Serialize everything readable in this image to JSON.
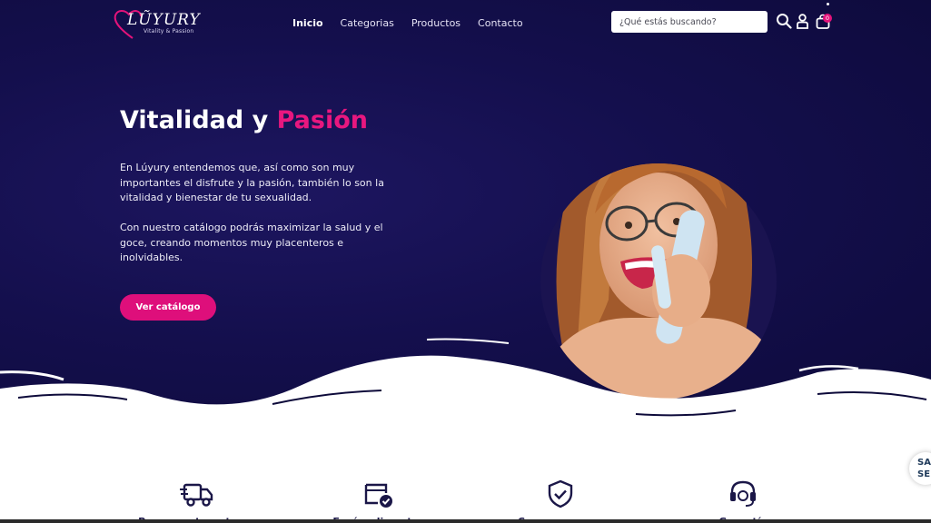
{
  "nav": {
    "brand": "LŨYURY",
    "tagline": "Vitality & Passion",
    "links": [
      "Inicio",
      "Categorias",
      "Productos",
      "Contacto"
    ],
    "active_index": 0,
    "search_placeholder": "¿Qué estás buscando?",
    "cart_count": "0",
    "icons": [
      "search-icon",
      "user-icon",
      "cart-icon"
    ]
  },
  "hero": {
    "title_main": "Vitalidad y ",
    "title_accent": "Pasión",
    "paragraph_1": "En Lúyury entendemos que, así como son muy importantes el disfrute y la pasión, también lo son la vitalidad y bienestar de tu sexualidad.",
    "paragraph_2": "Con nuestro catálogo podrás maximizar la salud y el goce, creando momentos muy placenteros e inolvidables.",
    "cta_label": "Ver catálogo"
  },
  "features": [
    {
      "label": "Pagos contraentrega",
      "icon": "delivery-truck-icon"
    },
    {
      "label": "Envíos discretos",
      "icon": "package-check-icon"
    },
    {
      "label": "Compra segura",
      "icon": "shield-check-icon"
    },
    {
      "label": "Garantía",
      "icon": "headset-icon"
    }
  ],
  "side_badge": {
    "line1": "SA",
    "line2": "SE"
  },
  "colors": {
    "hero_bg": "#140f4d",
    "accent": "#e3137a",
    "feature_text": "#1b1748"
  }
}
